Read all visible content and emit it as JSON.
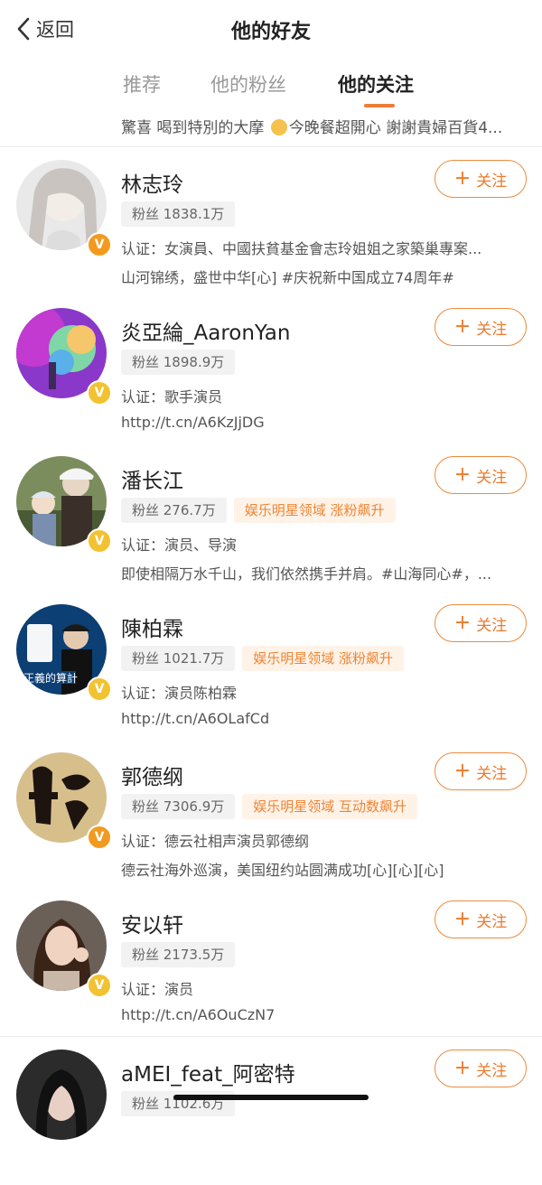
{
  "header": {
    "back_label": "返回",
    "title": "他的好友"
  },
  "tabs": [
    {
      "label": "推荐",
      "active": false
    },
    {
      "label": "他的粉丝",
      "active": false
    },
    {
      "label": "他的关注",
      "active": true
    }
  ],
  "partial_line": {
    "text_before": "驚喜 喝到特別的大摩 ",
    "emoji": "smiling-face-hearts-icon",
    "text_after": "今晚餐超開心 謝謝貴婦百貨4..."
  },
  "follow_label": "关注",
  "colors": {
    "accent": "#ef7b38",
    "verified_orange": "#f39a1e",
    "verified_yellow": "#f2c230"
  },
  "users": [
    {
      "name": "林志玲",
      "fans": "粉丝 1838.1万",
      "tag": "",
      "line1": "认证：女演員、中國扶貧基金會志玲姐姐之家築巢專案...",
      "line2": "山河锦绣，盛世中华[心] #庆祝新中国成立74周年#",
      "badge": "orange"
    },
    {
      "name": "炎亞綸_AaronYan",
      "fans": "粉丝 1898.9万",
      "tag": "",
      "line1": "认证：歌手演员",
      "line2": "http://t.cn/A6KzJjDG",
      "badge": "yellow"
    },
    {
      "name": "潘长江",
      "fans": "粉丝 276.7万",
      "tag": "娱乐明星领域 涨粉飙升",
      "line1": "认证：演员、导演",
      "line2": "即使相隔万水千山，我们依然携手并肩。#山海同心#，...",
      "badge": "yellow"
    },
    {
      "name": "陳柏霖",
      "fans": "粉丝 1021.7万",
      "tag": "娱乐明星领域 涨粉飙升",
      "line1": "认证：演员陈柏霖",
      "line2": "http://t.cn/A6OLafCd",
      "badge": "yellow"
    },
    {
      "name": "郭德纲",
      "fans": "粉丝 7306.9万",
      "tag": "娱乐明星领域 互动数飙升",
      "line1": "认证：德云社相声演员郭德纲",
      "line2": "德云社海外巡演，美国纽约站圆满成功[心][心][心]",
      "badge": "orange"
    },
    {
      "name": "安以轩",
      "fans": "粉丝 2173.5万",
      "tag": "",
      "line1": "认证：演员",
      "line2": "http://t.cn/A6OuCzN7",
      "badge": "yellow"
    },
    {
      "name": "aMEI_feat_阿密特",
      "fans": "粉丝 1102.6万",
      "tag": "",
      "line1": "",
      "line2": "",
      "badge": "yellow"
    }
  ]
}
